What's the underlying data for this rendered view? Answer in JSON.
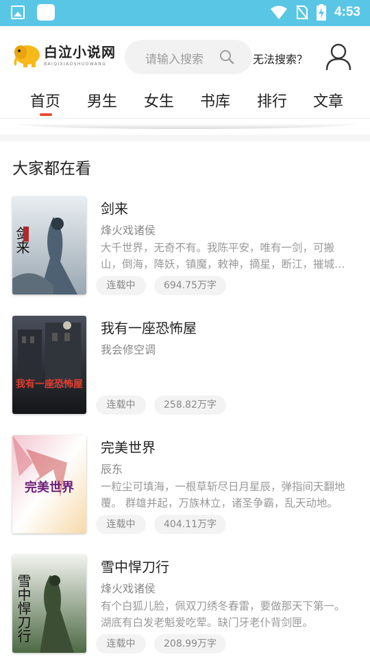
{
  "status_bar": {
    "time": "4:53"
  },
  "header": {
    "logo_title": "白泣小说网",
    "logo_sub": "BAIQIXIAOSHUOWANG",
    "search_placeholder": "请输入搜索",
    "cant_search": "无法搜索？"
  },
  "tabs": [
    {
      "label": "首页"
    },
    {
      "label": "男生"
    },
    {
      "label": "女生"
    },
    {
      "label": "书库"
    },
    {
      "label": "排行"
    },
    {
      "label": "文章"
    }
  ],
  "section_title": "大家都在看",
  "books": [
    {
      "title": "剑来",
      "author": "烽火戏诸侯",
      "desc": "大千世界，无奇不有。我陈平安，唯有一剑，可搬山，倒海，降妖，镇魔，敕神，摘星，断江，摧城，开天！",
      "status": "连载中",
      "words": "694.75万字",
      "cover_text": "剑来"
    },
    {
      "title": "我有一座恐怖屋",
      "author": "我会修空调",
      "desc": "",
      "status": "连载中",
      "words": "258.82万字",
      "cover_text": "我有一座恐怖屋"
    },
    {
      "title": "完美世界",
      "author": "辰东",
      "desc": "一粒尘可填海，一根草斩尽日月星辰，弹指间天翻地覆。 群雄并起，万族林立，诸圣争霸，乱天动地。",
      "status": "连载中",
      "words": "404.11万字",
      "cover_text": "完美世界"
    },
    {
      "title": "雪中悍刀行",
      "author": "烽火戏诸侯",
      "desc": "有个白狐儿脸，佩双刀绣冬春雷，要做那天下第一。湖底有白发老魁爱吃荤。缺门牙老仆背剑匣。",
      "status": "连载中",
      "words": "208.99万字",
      "cover_text": "雪中悍刀行"
    }
  ]
}
